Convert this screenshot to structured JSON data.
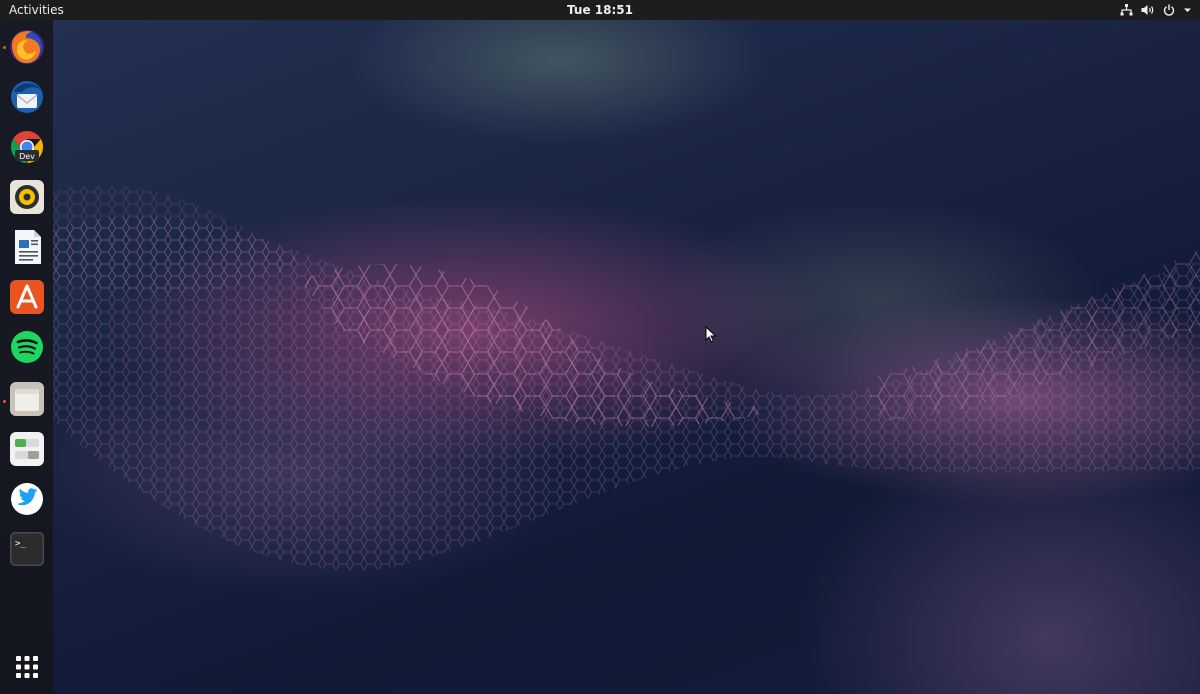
{
  "topbar": {
    "activities_label": "Activities",
    "clock": "Tue 18:51",
    "tray_icons": [
      "network-icon",
      "volume-icon",
      "power-icon",
      "chevron-down-icon"
    ]
  },
  "dock": {
    "apps": [
      {
        "name": "firefox",
        "icon": "firefox-icon",
        "running": true
      },
      {
        "name": "thunderbird",
        "icon": "thunderbird-icon",
        "running": false
      },
      {
        "name": "chrome-dev",
        "icon": "chrome-dev-icon",
        "badge": "Dev",
        "running": false
      },
      {
        "name": "rhythmbox",
        "icon": "rhythmbox-icon",
        "running": false
      },
      {
        "name": "libreoffice-writer",
        "icon": "document-icon",
        "running": false
      },
      {
        "name": "ubuntu-software",
        "icon": "software-store-icon",
        "running": false
      },
      {
        "name": "spotify",
        "icon": "spotify-icon",
        "running": false
      },
      {
        "name": "files",
        "icon": "files-icon",
        "running": true
      },
      {
        "name": "settings-toggles",
        "icon": "toggle-switches-icon",
        "running": false
      },
      {
        "name": "twitter",
        "icon": "twitter-icon",
        "running": false
      },
      {
        "name": "terminal",
        "icon": "terminal-icon",
        "glyph": ">_",
        "running": false
      }
    ],
    "show_applications_icon": "app-grid-icon"
  },
  "colors": {
    "topbar_bg": "#1d1d1d",
    "running_indicator": "#e95420",
    "wallpaper_base": "#141c39",
    "wallpaper_accent": "#c4568c"
  }
}
